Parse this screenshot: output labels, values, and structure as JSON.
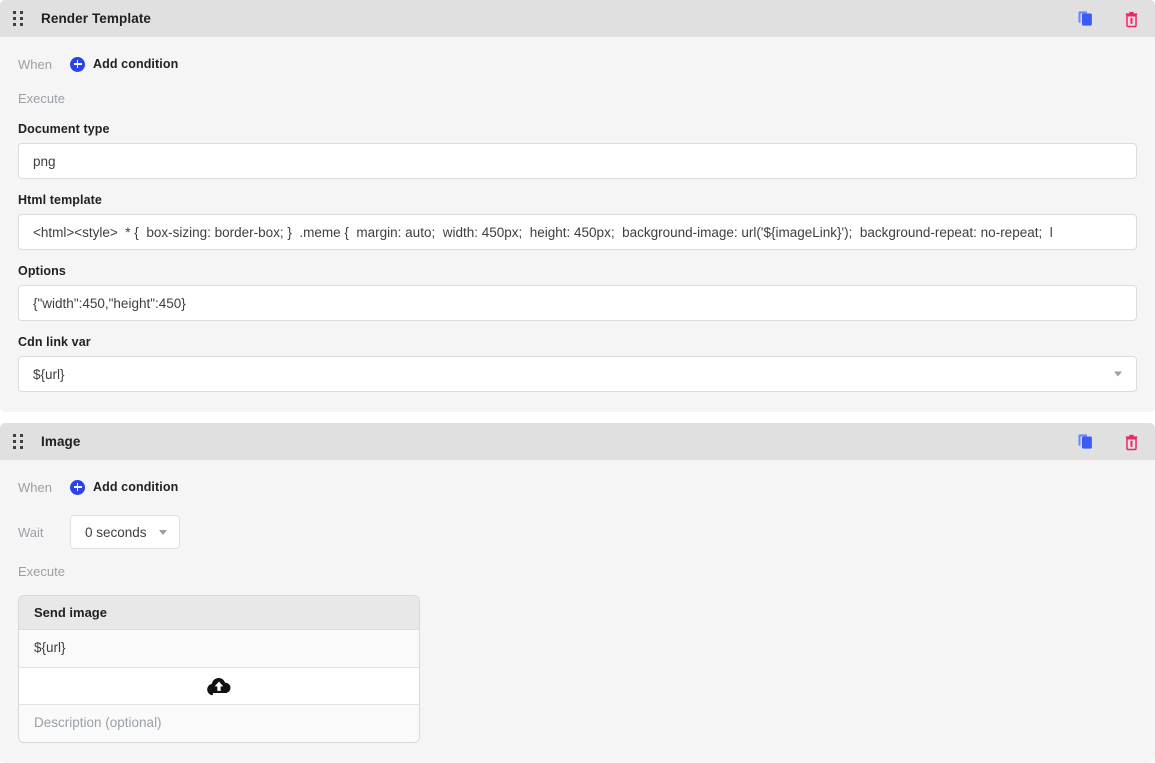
{
  "cards": [
    {
      "title": "Render Template",
      "drag_handle_icon": "drag-dots-icon",
      "actions": [
        {
          "icon": "copy-icon",
          "name": "duplicate-card-button",
          "color": "#3b5bf5"
        },
        {
          "icon": "trash-icon",
          "name": "delete-card-button",
          "color": "#f0246b"
        }
      ],
      "when_label": "When",
      "add_condition_label": "Add condition",
      "execute_label": "Execute",
      "fields": [
        {
          "label": "Document type",
          "value": "png",
          "type": "text"
        },
        {
          "label": "Html template",
          "value": "<html><style>  * {  box-sizing: border-box; }  .meme {  margin: auto;  width: 450px;  height: 450px;  background-image: url('${imageLink}');  background-repeat: no-repeat;  l",
          "type": "text"
        },
        {
          "label": "Options",
          "value": "{\"width\":450,\"height\":450}",
          "type": "text"
        },
        {
          "label": "Cdn link var",
          "value": "${url}",
          "type": "select"
        }
      ]
    },
    {
      "title": "Image",
      "drag_handle_icon": "drag-dots-icon",
      "actions": [
        {
          "icon": "copy-icon",
          "name": "duplicate-card-button",
          "color": "#3b5bf5"
        },
        {
          "icon": "trash-icon",
          "name": "delete-card-button",
          "color": "#f0246b"
        }
      ],
      "when_label": "When",
      "add_condition_label": "Add condition",
      "wait_label": "Wait",
      "wait_value": "0 seconds",
      "execute_label": "Execute",
      "send_panel": {
        "header": "Send image",
        "url_value": "${url}",
        "upload_icon": "cloud-upload-icon",
        "description_placeholder": "Description (optional)"
      }
    }
  ],
  "colors": {
    "card_background": "#f5f5f5",
    "card_header_background": "#e0e0e0",
    "accent_blue": "#2b44e8",
    "copy_icon": "#3b5bf5",
    "trash_icon": "#f0246b",
    "muted_text": "#9aa0a6",
    "primary_text": "#202124"
  }
}
